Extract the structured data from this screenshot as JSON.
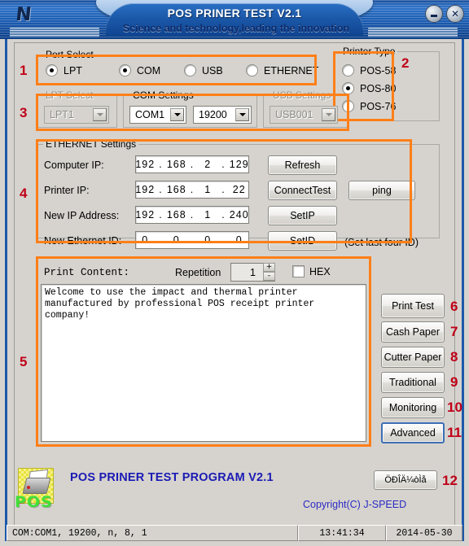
{
  "window": {
    "title": "POS PRINER TEST V2.1",
    "subtitle": "Science and technology,leading the innovation",
    "logo_glyph": "N",
    "minimize_label": "",
    "close_label": "✕"
  },
  "port_select": {
    "title": "Port Select",
    "marker": "1",
    "options": [
      {
        "label": "LPT",
        "selected": false
      },
      {
        "label": "COM",
        "selected": true
      },
      {
        "label": "USB",
        "selected": false
      },
      {
        "label": "ETHERNET",
        "selected": false
      }
    ]
  },
  "printer_type": {
    "title": "Printer Type",
    "marker": "2",
    "options": [
      {
        "label": "POS-58",
        "selected": false
      },
      {
        "label": "POS-80",
        "selected": true
      },
      {
        "label": "POS-76",
        "selected": false
      }
    ]
  },
  "port_settings": {
    "marker": "3",
    "lpt": {
      "title": "LPT Select",
      "value": "LPT1",
      "disabled": true
    },
    "com": {
      "title": "COM Settings",
      "port_value": "COM1",
      "baud_value": "19200",
      "disabled": false
    },
    "usb": {
      "title": "USB Settings",
      "value": "USB001",
      "disabled": true
    }
  },
  "ethernet": {
    "title": "ETHERNET Settings",
    "marker": "4",
    "rows": [
      {
        "label": "Computer IP:",
        "octets": [
          "192",
          "168",
          "2",
          "129"
        ]
      },
      {
        "label": "Printer IP:",
        "octets": [
          "192",
          "168",
          "1",
          "22"
        ]
      },
      {
        "label": "New IP Address:",
        "octets": [
          "192",
          "168",
          "1",
          "240"
        ]
      },
      {
        "label": "New Ethernet ID:",
        "octets": [
          "0",
          "0",
          "0",
          "0"
        ]
      }
    ],
    "buttons": {
      "refresh": "Refresh",
      "connect_test": "ConnectTest",
      "set_ip": "SetIP",
      "set_id": "SetID",
      "ping": "ping"
    },
    "hint": "(Set last four ID)"
  },
  "print_content": {
    "marker": "5",
    "label": "Print Content:",
    "repetition_label": "Repetition",
    "repetition_value": "1",
    "spin_up": "+",
    "spin_down": "-",
    "hex_label": "HEX",
    "hex_checked": false,
    "text": "Welcome to use the impact and thermal printer\nmanufactured by professional POS receipt printer company!"
  },
  "action_buttons": [
    {
      "label": "Print Test",
      "marker": "6"
    },
    {
      "label": "Cash Paper",
      "marker": "7"
    },
    {
      "label": "Cutter Paper",
      "marker": "8"
    },
    {
      "label": "Traditional",
      "marker": "9"
    },
    {
      "label": "Monitoring",
      "marker": "10"
    },
    {
      "label": "Advanced",
      "marker": "11"
    }
  ],
  "footer": {
    "app_icon_text": "POS",
    "brand": "POS PRINER TEST PROGRAM V2.1",
    "copyright": "Copyright(C) J-SPEED",
    "language_button": "ÖÐÎÄ¼òÌå",
    "language_marker": "12"
  },
  "status_bar": {
    "connection": "COM:COM1, 19200, n, 8, 1",
    "time": "13:41:34",
    "date": "2014-05-30"
  },
  "colors": {
    "accent_orange": "#ff7f18",
    "marker_red": "#c00018",
    "title_blue": "#1c59a9",
    "brand_blue": "#1b1bb4",
    "face": "#d6d3ce"
  }
}
